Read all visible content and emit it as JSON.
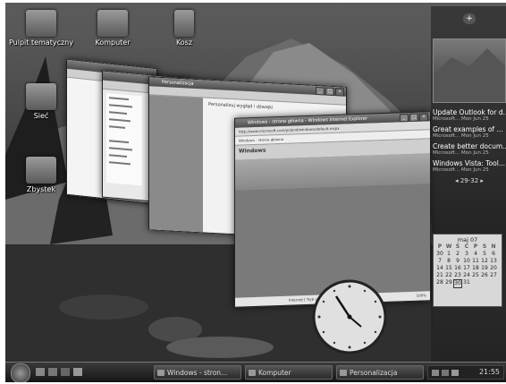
{
  "desktop": {
    "icons": [
      {
        "label": "Pulpit tematyczny"
      },
      {
        "label": "Komputer"
      },
      {
        "label": "Kosz"
      },
      {
        "label": "Sieć"
      },
      {
        "label": "Zbystek"
      }
    ]
  },
  "windows": {
    "explorer_title": "",
    "control_panel_title": "Personalizacja",
    "control_panel_heading": "Personalizuj wygląd i dźwięki",
    "ie_title": "Windows - strona główna - Windows Internet Explorer",
    "ie_address": "http://www.microsoft.com/poland/windows/default.mspx",
    "ie_tab": "Windows - strona główna",
    "ie_status": "Internet | Tryb chroniony: włączony",
    "ie_zoom": "100%",
    "ie_logo": "Windows"
  },
  "sidebar": {
    "plus_label": "+",
    "feed_items": [
      {
        "title": "Update Outlook for d...",
        "sub": "Microsoft... Mon Jun 25"
      },
      {
        "title": "Great examples of ...",
        "sub": "Microsoft... Mon Jun 25"
      },
      {
        "title": "Create better docum...",
        "sub": "Microsoft... Mon Jun 25"
      },
      {
        "title": "Windows Vista: Tool...",
        "sub": "Microsoft... Mon Jun 25"
      }
    ],
    "feed_nav": "29-32",
    "calendar": {
      "month": "maj 07",
      "weekdays": [
        "P",
        "W",
        "Ś",
        "C",
        "P",
        "S",
        "N"
      ],
      "rows": [
        [
          "30",
          "1",
          "2",
          "3",
          "4",
          "5",
          "6"
        ],
        [
          "7",
          "8",
          "9",
          "10",
          "11",
          "12",
          "13"
        ],
        [
          "14",
          "15",
          "16",
          "17",
          "18",
          "19",
          "20"
        ],
        [
          "21",
          "22",
          "23",
          "24",
          "25",
          "26",
          "27"
        ],
        [
          "28",
          "29",
          "30",
          "31",
          "",
          "",
          ""
        ]
      ],
      "today": "30"
    }
  },
  "taskbar": {
    "buttons": [
      {
        "label": "Windows - stron..."
      },
      {
        "label": "Komputer"
      },
      {
        "label": "Personalizacja"
      }
    ],
    "clock": "21:55"
  },
  "colors": {
    "taskbar": "#1e1e1e",
    "gadget_bg": "#2b2b2b"
  }
}
